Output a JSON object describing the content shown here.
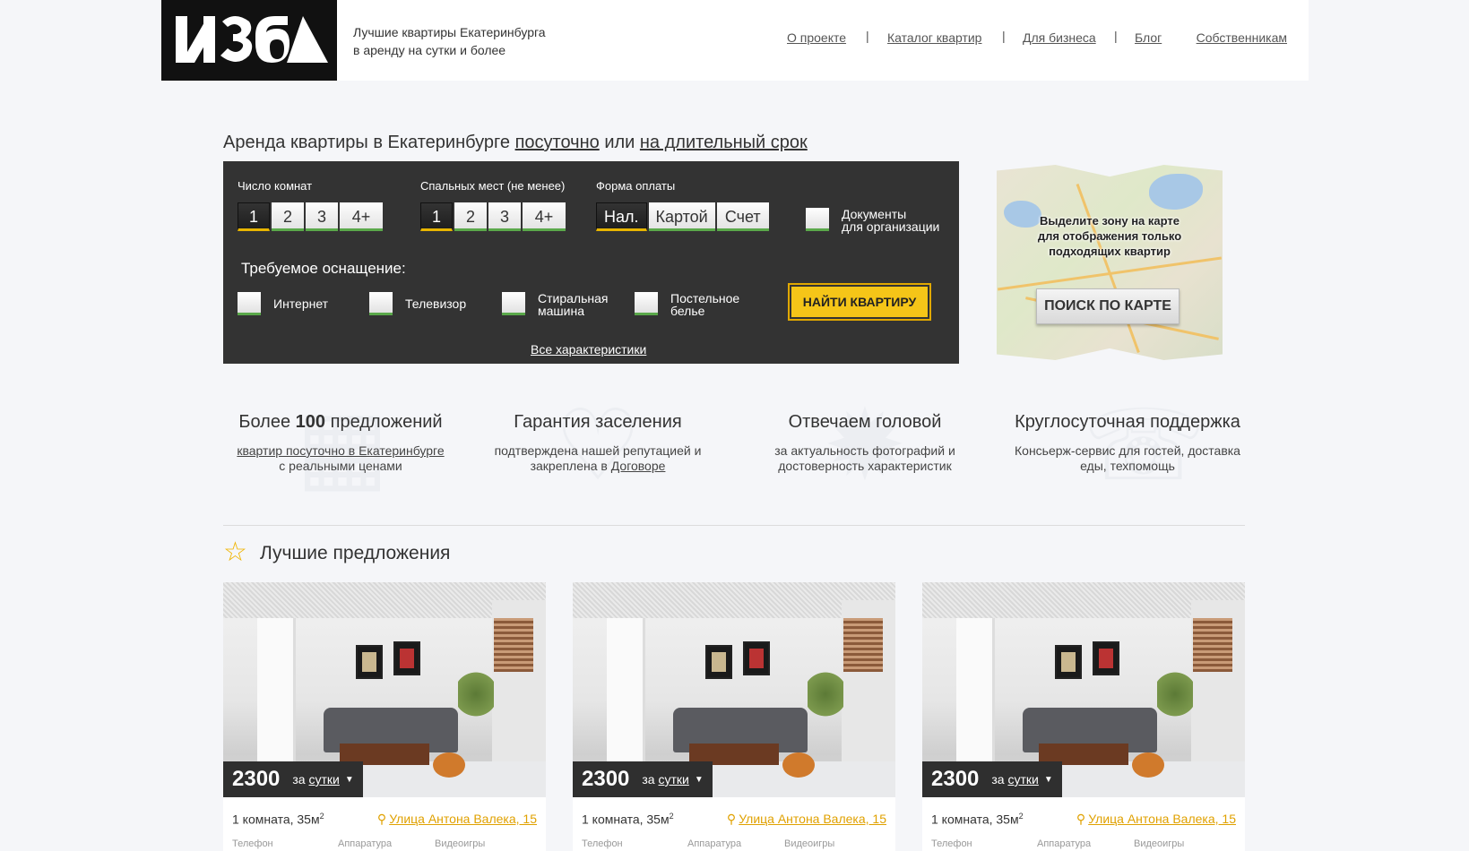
{
  "header": {
    "tagline_line1": "Лучшие квартиры Екатеринбурга",
    "tagline_line2": "в аренду на сутки и более",
    "nav": [
      "О проекте",
      "Каталог квартир",
      "Для бизнеса",
      "Блог"
    ],
    "owners_link": "Собственникам"
  },
  "heading": {
    "prefix": "Аренда квартиры в Екатеринбурге",
    "link1": "посуточно",
    "middle": "или",
    "link2": "на длительный срок"
  },
  "search": {
    "rooms_label": "Число комнат",
    "rooms_options": [
      "1",
      "2",
      "3",
      "4+"
    ],
    "beds_label": "Спальных мест (не менее)",
    "beds_options": [
      "1",
      "2",
      "3",
      "4+"
    ],
    "payment_label": "Форма оплаты",
    "payment_options": [
      "Нал.",
      "Картой",
      "Счет"
    ],
    "docs_label_1": "Документы",
    "docs_label_2": "для организации",
    "equipment_title": "Требуемое оснащение:",
    "equipment": [
      {
        "l1": "Интернет",
        "l2": ""
      },
      {
        "l1": "Телевизор",
        "l2": ""
      },
      {
        "l1": "Стиральная",
        "l2": "машина"
      },
      {
        "l1": "Постельное",
        "l2": "белье"
      }
    ],
    "find_button": "НАЙТИ КВАРТИРУ",
    "all_chars": "Все характеристики"
  },
  "map": {
    "hint_1": "Выделите зону на карте",
    "hint_2": "для отображения только",
    "hint_3": "подходящих квартир",
    "button": "ПОИСК ПО КАРТЕ"
  },
  "features": [
    {
      "title_pre": "Более",
      "title_bold": "100",
      "title_post": "предложений",
      "line1_link": "квартир посуточно в Екатеринбурге",
      "line2": "с реальными ценами"
    },
    {
      "title": "Гарантия заселения",
      "line1": "подтверждена нашей репутацией и",
      "line2_pre": "закреплена в",
      "line2_link": "Договоре"
    },
    {
      "title": "Отвечаем головой",
      "line1": "за актуальность фотографий и",
      "line2": "достоверность характеристик"
    },
    {
      "title": "Круглосуточная поддержка",
      "line1": "Консьерж-сервис для гостей, доставка",
      "line2": "еды, техпомощь"
    }
  ],
  "best": {
    "title": "Лучшие предложения",
    "cards": [
      {
        "price": "2300",
        "per_pre": "за",
        "per_link": "сутки",
        "rooms": "1 комната, 35м",
        "area_sup": "2",
        "address": "Улица Антона Валека, 15",
        "amenities": [
          "Телефон",
          "Аппаратура",
          "Видеоигры"
        ]
      },
      {
        "price": "2300",
        "per_pre": "за",
        "per_link": "сутки",
        "rooms": "1 комната, 35м",
        "area_sup": "2",
        "address": "Улица Антона Валека, 15",
        "amenities": [
          "Телефон",
          "Аппаратура",
          "Видеоигры"
        ]
      },
      {
        "price": "2300",
        "per_pre": "за",
        "per_link": "сутки",
        "rooms": "1 комната, 35м",
        "area_sup": "2",
        "address": "Улица Антона Валека, 15",
        "amenities": [
          "Телефон",
          "Аппаратура",
          "Видеоигры"
        ]
      }
    ]
  },
  "colors": {
    "accent": "#f5c518",
    "panel": "#333333",
    "link_orange": "#e0a100",
    "ok_green": "#5aa84a"
  },
  "icons": {
    "logo": "izba-logo",
    "star": "star-outline-icon",
    "pin": "map-pin-icon",
    "caret": "caret-down-icon"
  }
}
